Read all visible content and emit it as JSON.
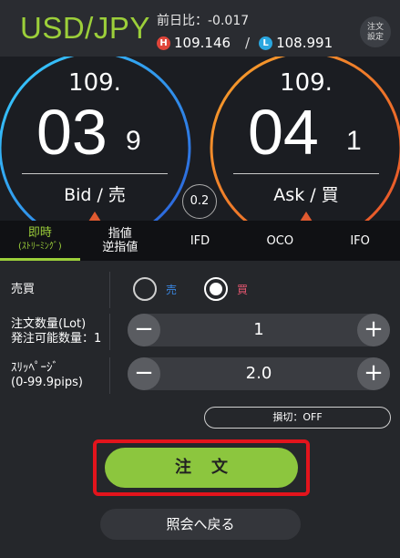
{
  "header": {
    "pair": "USD/JPY",
    "prev_day_label": "前日比：",
    "prev_day_value": "-0.017",
    "high_badge": "H",
    "high_value": "109.146",
    "separator": "/",
    "low_badge": "L",
    "low_value": "108.991",
    "order_settings_line1": "注文",
    "order_settings_line2": "設定"
  },
  "bid": {
    "prefix": "109.",
    "pips": "03",
    "fraction": "9",
    "label": "Bid / 売"
  },
  "ask": {
    "prefix": "109.",
    "pips": "04",
    "fraction": "1",
    "label": "Ask / 買"
  },
  "spread": "0.2",
  "tabs": [
    {
      "label": "即時",
      "sub": "(ｽﾄﾘｰﾐﾝｸﾞ)",
      "active": true
    },
    {
      "label": "指値",
      "sub": "逆指値",
      "active": false
    },
    {
      "label": "IFD",
      "sub": "",
      "active": false
    },
    {
      "label": "OCO",
      "sub": "",
      "active": false
    },
    {
      "label": "IFO",
      "sub": "",
      "active": false
    }
  ],
  "form": {
    "side_label": "売買",
    "sell_option": "売",
    "buy_option": "買",
    "selected_side": "buy",
    "qty_label_line1": "注文数量(Lot)",
    "qty_label_line2": "発注可能数量：1",
    "qty_value": "1",
    "slippage_label_line1": "ｽﾘｯﾍﾟｰｼﾞ",
    "slippage_label_line2": "(0-99.9pips)",
    "slippage_value": "2.0",
    "minus_glyph": "−",
    "plus_glyph": "+",
    "stoploss_label": "損切：OFF",
    "order_button": "注文",
    "back_button": "照会へ戻る"
  },
  "colors": {
    "accent_green": "#9ccf3a",
    "order_green": "#8cc63e",
    "highlight_red": "#e3141c",
    "bid_ring": "#3a9be0",
    "ask_ring": "#f07a28"
  }
}
